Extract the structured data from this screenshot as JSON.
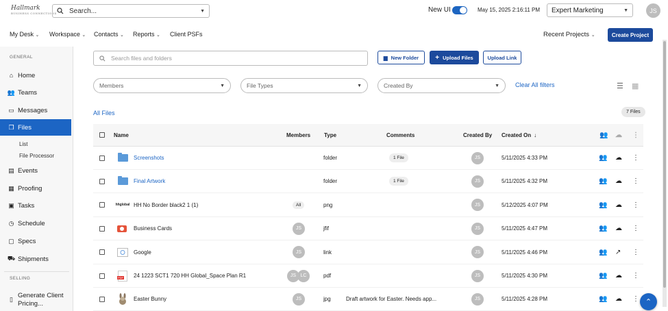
{
  "app": {
    "logo": "Hallmark",
    "logo_sub": "BUSINESS CONNECTIONS"
  },
  "topbar": {
    "search_placeholder": "Search...",
    "new_ui_label": "New UI",
    "datetime": "May 15, 2025 2:16:11 PM",
    "company": "Expert Marketing",
    "user_initials": "JS"
  },
  "nav": {
    "items": [
      "My Desk",
      "Workspace",
      "Contacts",
      "Reports",
      "Client PSFs"
    ],
    "recent_projects": "Recent Projects",
    "create_project": "Create Project"
  },
  "sidebar": {
    "general_label": "GENERAL",
    "items": [
      {
        "label": "Home",
        "icon": "home-icon"
      },
      {
        "label": "Teams",
        "icon": "teams-icon"
      },
      {
        "label": "Messages",
        "icon": "messages-icon"
      },
      {
        "label": "Files",
        "icon": "files-icon",
        "active": true
      },
      {
        "label": "Events",
        "icon": "events-icon"
      },
      {
        "label": "Proofing",
        "icon": "proofing-icon"
      },
      {
        "label": "Tasks",
        "icon": "tasks-icon"
      },
      {
        "label": "Schedule",
        "icon": "schedule-icon"
      },
      {
        "label": "Specs",
        "icon": "specs-icon"
      },
      {
        "label": "Shipments",
        "icon": "shipments-icon"
      }
    ],
    "files_sub": [
      "List",
      "File Processor"
    ],
    "selling_label": "SELLING",
    "selling_items": [
      {
        "label": "Generate Client",
        "label2": "Pricing...",
        "icon": "document-icon"
      }
    ]
  },
  "files": {
    "search_placeholder": "Search files and folders",
    "new_folder": "New Folder",
    "upload_files": "Upload Files",
    "upload_link": "Upload Link",
    "filter_members": "Members",
    "filter_types": "File Types",
    "filter_created_by": "Created By",
    "clear_filters": "Clear All filters",
    "all_files": "All Files",
    "count": "7 Files",
    "columns": {
      "name": "Name",
      "members": "Members",
      "type": "Type",
      "comments": "Comments",
      "created_by": "Created By",
      "created_on": "Created On"
    },
    "rows": [
      {
        "name": "Screenshots",
        "kind": "folder",
        "members": [],
        "members_all": "",
        "type": "folder",
        "comment": "1 File",
        "creator": "JS",
        "created_on": "5/11/2025 4:33 PM",
        "action": "download"
      },
      {
        "name": "Final Artwork",
        "kind": "folder",
        "members": [],
        "members_all": "",
        "type": "folder",
        "comment": "1 File",
        "creator": "JS",
        "created_on": "5/11/2025 4:32 PM",
        "action": "download"
      },
      {
        "name": "HH No Border black2 1 (1)",
        "kind": "hhglobal",
        "thumb_text": "hhglobal",
        "members": [],
        "members_all": "All",
        "type": "png",
        "comment": "",
        "creator": "JS",
        "created_on": "5/12/2025 4:07 PM",
        "action": "download"
      },
      {
        "name": "Business Cards",
        "kind": "ppt",
        "members": [
          "JS"
        ],
        "members_all": "",
        "type": "jfif",
        "comment": "",
        "creator": "JS",
        "created_on": "5/11/2025 4:47 PM",
        "action": "download"
      },
      {
        "name": "Google",
        "kind": "link",
        "members": [
          "JS"
        ],
        "members_all": "",
        "type": "link",
        "comment": "",
        "creator": "JS",
        "created_on": "5/11/2025 4:46 PM",
        "action": "open"
      },
      {
        "name": "24 1223 SCT1 720 HH Global_Space Plan R1",
        "kind": "pdf",
        "thumb_text": "PDF",
        "members": [
          "JS",
          "LC"
        ],
        "members_all": "",
        "type": "pdf",
        "comment": "",
        "creator": "JS",
        "created_on": "5/11/2025 4:30 PM",
        "action": "download"
      },
      {
        "name": "Easter Bunny",
        "kind": "image",
        "members": [
          "JS"
        ],
        "members_all": "",
        "type": "jpg",
        "comment": "Draft artwork for Easter. Needs app...",
        "creator": "JS",
        "created_on": "5/11/2025 4:28 PM",
        "action": "download"
      }
    ]
  }
}
